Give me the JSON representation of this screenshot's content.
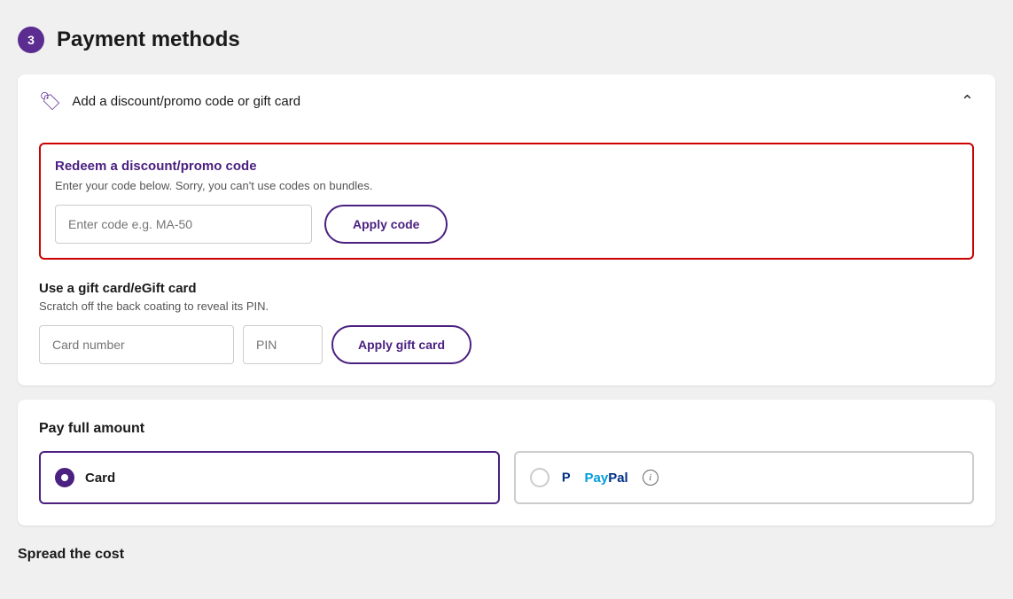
{
  "page": {
    "step_number": "3",
    "step_label": "Payment methods"
  },
  "discount_panel": {
    "header_text": "Add a discount/promo code or gift card"
  },
  "promo_section": {
    "title": "Redeem a discount/promo code",
    "subtitle": "Enter your code below. Sorry, you can't use codes on bundles.",
    "input_placeholder": "Enter code e.g. MA-50",
    "apply_button_label": "Apply code"
  },
  "gift_section": {
    "title": "Use a gift card/eGift card",
    "subtitle": "Scratch off the back coating to reveal its PIN.",
    "card_number_placeholder": "Card number",
    "pin_placeholder": "PIN",
    "apply_button_label": "Apply gift card"
  },
  "pay_full_amount": {
    "title": "Pay full amount",
    "options": [
      {
        "id": "card",
        "label": "Card",
        "selected": true
      },
      {
        "id": "paypal",
        "label": "PayPal",
        "selected": false
      }
    ]
  },
  "spread_cost": {
    "title": "Spread the cost"
  }
}
